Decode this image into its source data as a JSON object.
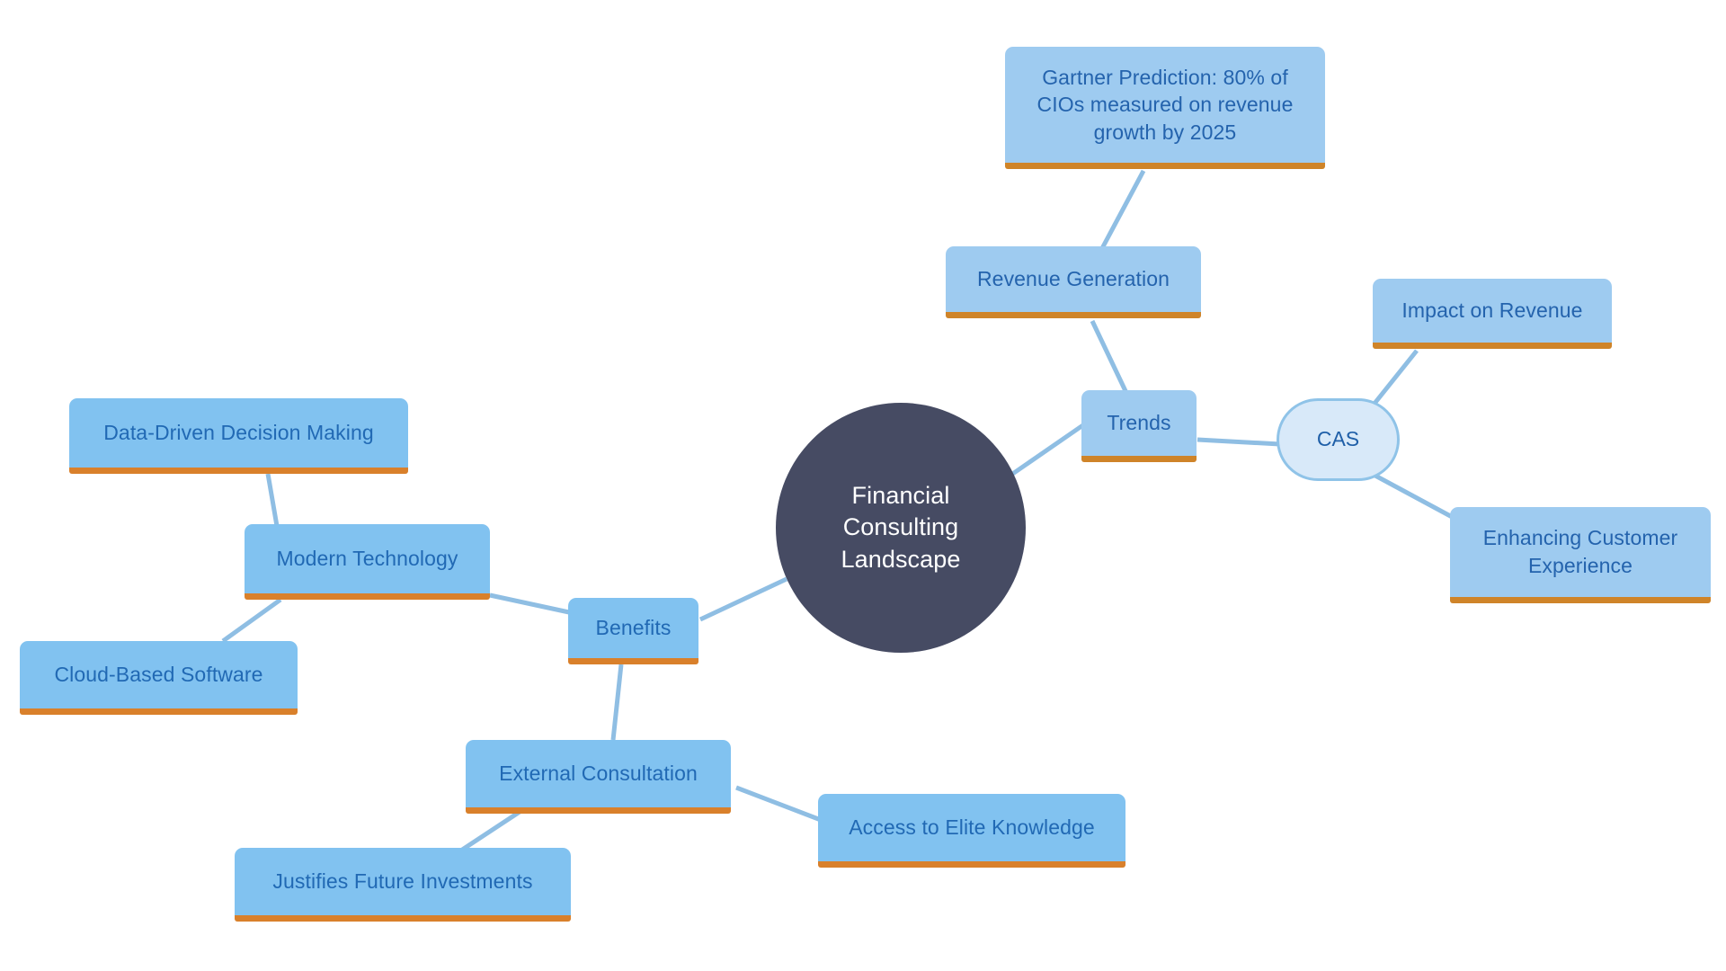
{
  "diagram": {
    "type": "mind-map",
    "title": "Financial Consulting Landscape",
    "background_color": "#ffffff",
    "root": {
      "id": "root",
      "label": "Financial Consulting\nLandscape",
      "shape": "circle",
      "fill_color": "#464b63",
      "text_color": "#ffffff"
    },
    "colors": {
      "node_fill": "#81c2f0",
      "node_fill_pale": "#9ecbf0",
      "node_text": "#2169b4",
      "node_underline": "#d9802b",
      "edge": "#8fbee3",
      "pill_fill": "#d8e9f9",
      "pill_border": "#8fc3e8"
    },
    "nodes": [
      {
        "id": "gartner",
        "label": "Gartner Prediction: 80% of\nCIOs measured on revenue\ngrowth by 2025",
        "shape": "box",
        "style": "pale",
        "branch": "trends"
      },
      {
        "id": "revenue",
        "label": "Revenue Generation",
        "shape": "box",
        "style": "pale",
        "branch": "trends"
      },
      {
        "id": "trends",
        "label": "Trends",
        "shape": "box",
        "style": "pale",
        "branch": "trends"
      },
      {
        "id": "cas",
        "label": "CAS",
        "shape": "pill",
        "style": "pill",
        "branch": "trends"
      },
      {
        "id": "impact",
        "label": "Impact on Revenue",
        "shape": "box",
        "style": "pale",
        "branch": "cas"
      },
      {
        "id": "enhancing",
        "label": "Enhancing Customer\nExperience",
        "shape": "box",
        "style": "pale",
        "branch": "cas"
      },
      {
        "id": "benefits",
        "label": "Benefits",
        "shape": "box",
        "style": "bright",
        "branch": "benefits"
      },
      {
        "id": "modern",
        "label": "Modern Technology",
        "shape": "box",
        "style": "bright",
        "branch": "benefits"
      },
      {
        "id": "datadriven",
        "label": "Data-Driven Decision Making",
        "shape": "box",
        "style": "bright",
        "branch": "benefits"
      },
      {
        "id": "cloud",
        "label": "Cloud-Based Software",
        "shape": "box",
        "style": "bright",
        "branch": "benefits"
      },
      {
        "id": "external",
        "label": "External Consultation",
        "shape": "box",
        "style": "bright",
        "branch": "benefits"
      },
      {
        "id": "elite",
        "label": "Access to Elite Knowledge",
        "shape": "box",
        "style": "bright",
        "branch": "benefits"
      },
      {
        "id": "justifies",
        "label": "Justifies Future Investments",
        "shape": "box",
        "style": "bright",
        "branch": "benefits"
      }
    ],
    "edges": [
      {
        "from": "root",
        "to": "trends"
      },
      {
        "from": "trends",
        "to": "revenue"
      },
      {
        "from": "revenue",
        "to": "gartner"
      },
      {
        "from": "trends",
        "to": "cas"
      },
      {
        "from": "cas",
        "to": "impact"
      },
      {
        "from": "cas",
        "to": "enhancing"
      },
      {
        "from": "root",
        "to": "benefits"
      },
      {
        "from": "benefits",
        "to": "modern"
      },
      {
        "from": "modern",
        "to": "datadriven"
      },
      {
        "from": "modern",
        "to": "cloud"
      },
      {
        "from": "benefits",
        "to": "external"
      },
      {
        "from": "external",
        "to": "elite"
      },
      {
        "from": "external",
        "to": "justifies"
      }
    ]
  }
}
